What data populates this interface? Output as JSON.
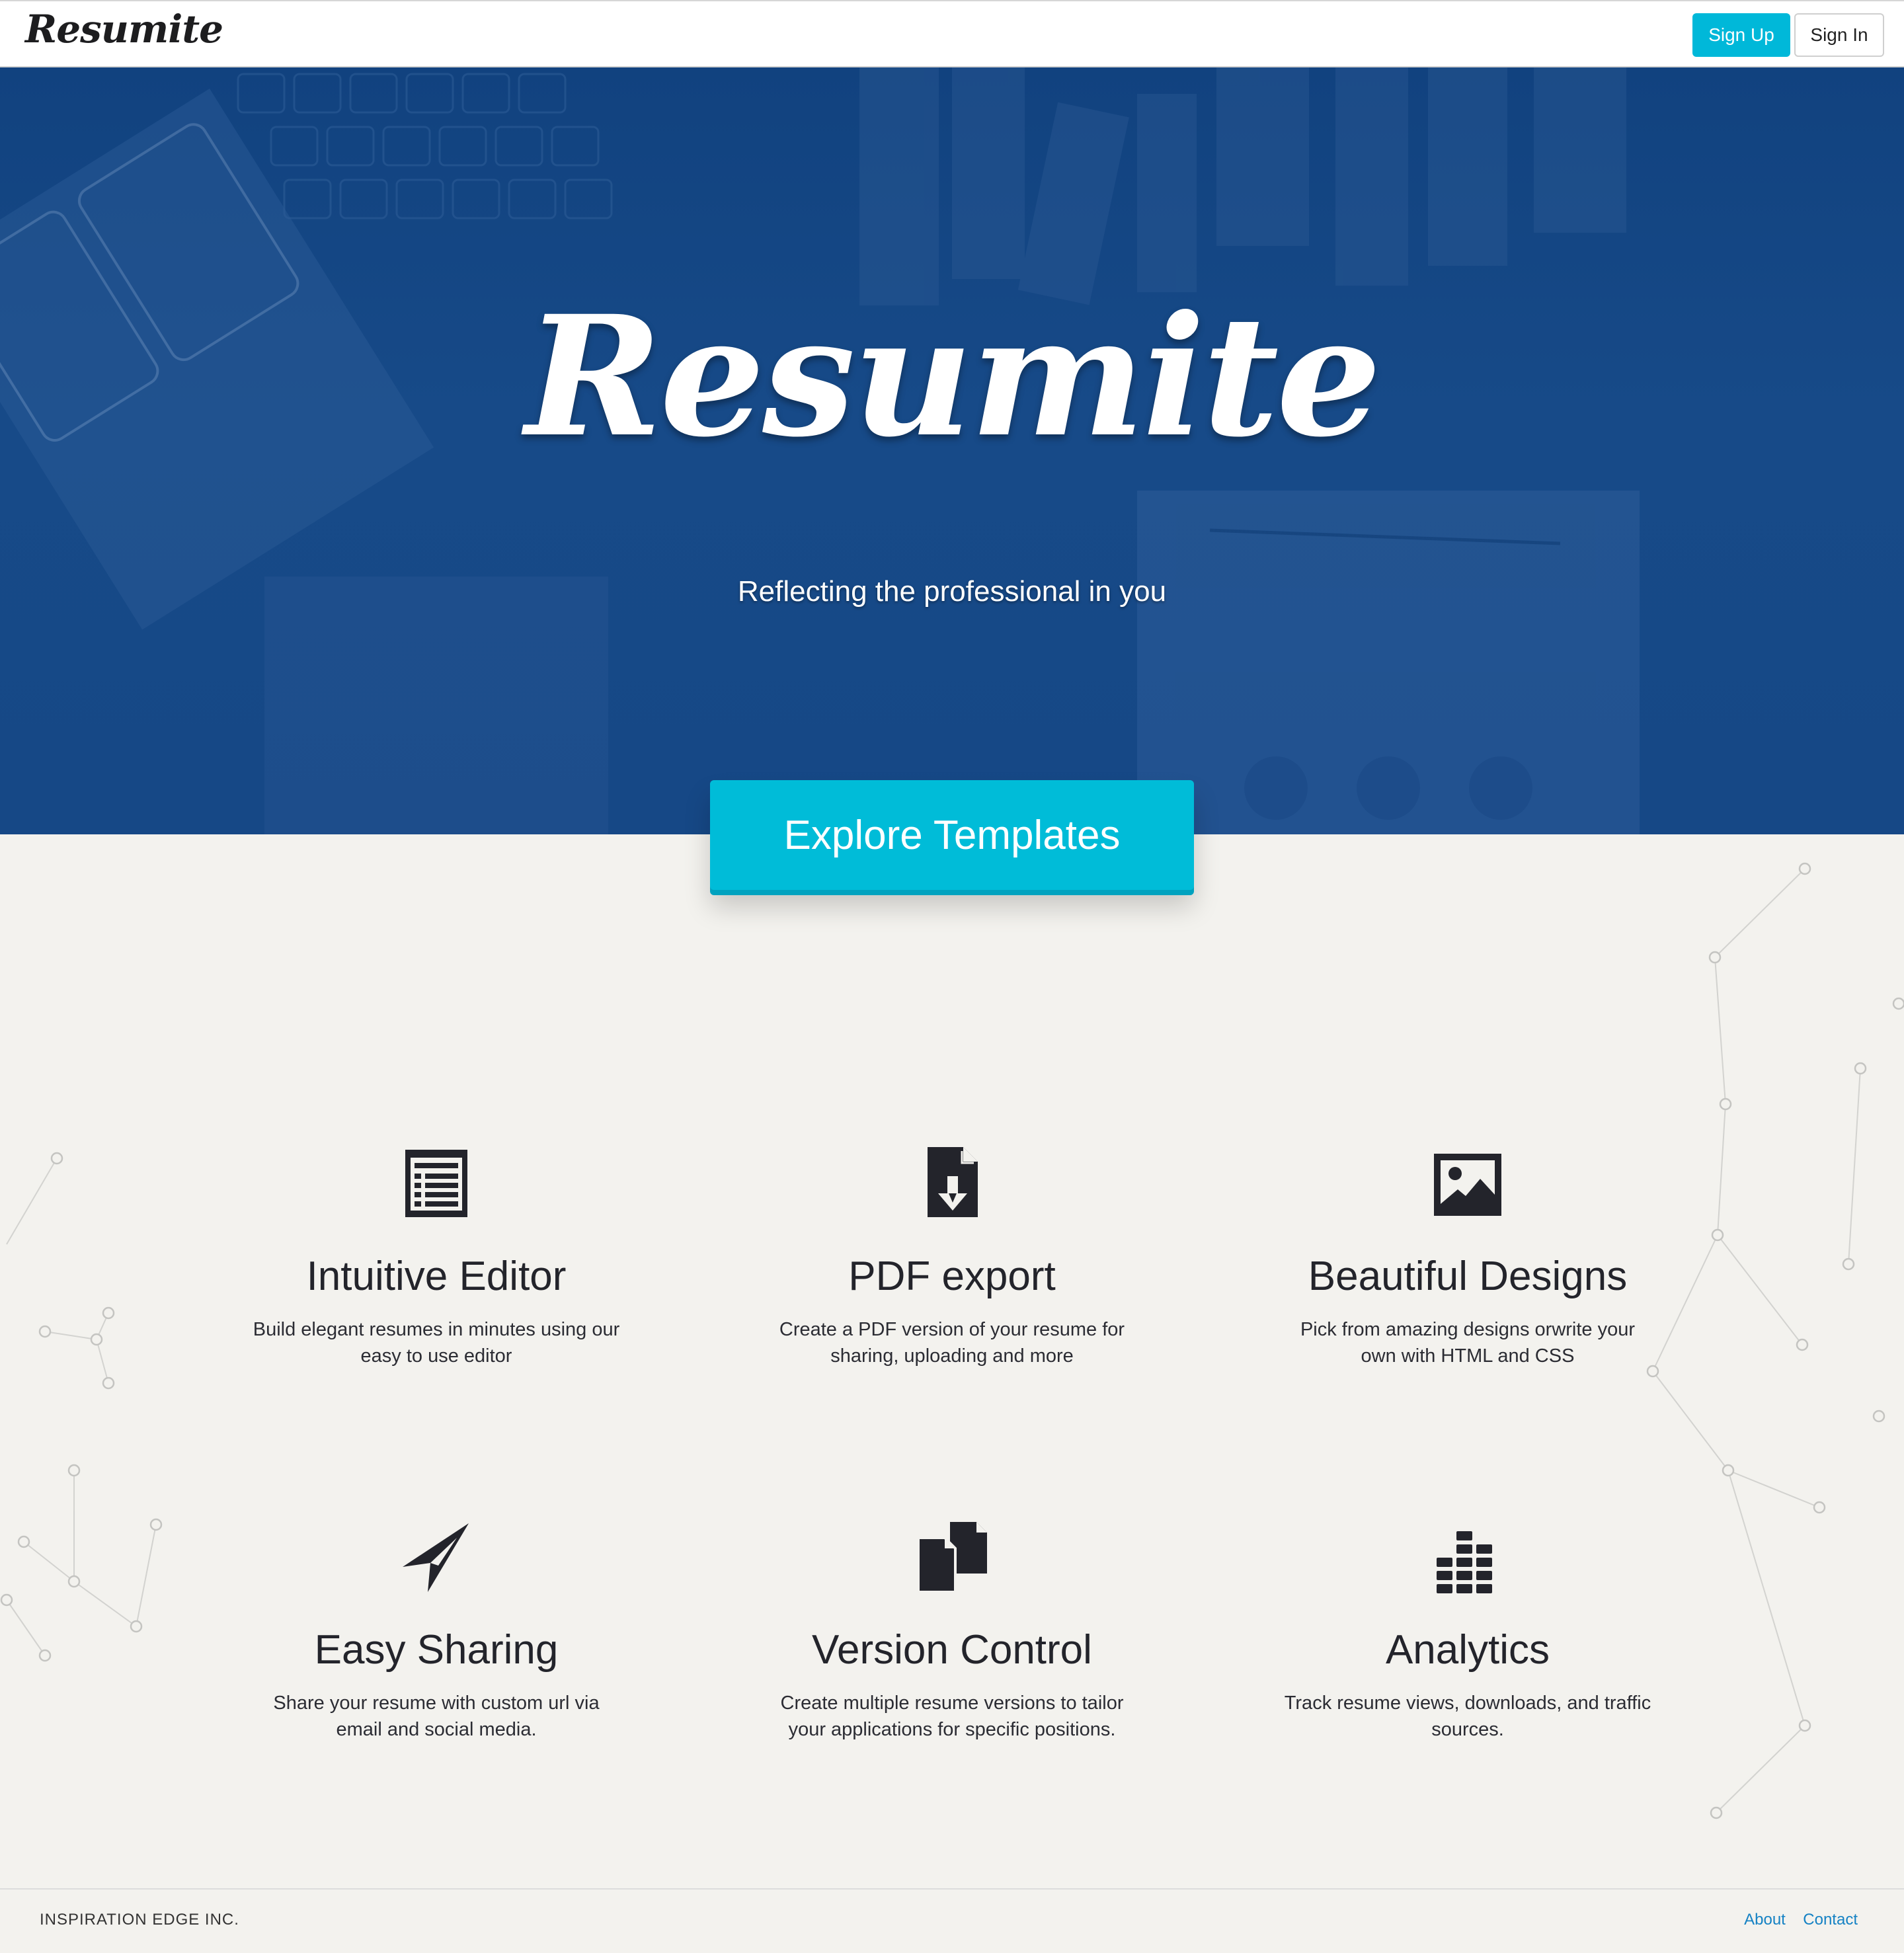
{
  "navbar": {
    "brand": "Resumite",
    "signup_label": "Sign Up",
    "signin_label": "Sign In"
  },
  "hero": {
    "title": "Resumite",
    "tagline": "Reflecting the professional in you",
    "cta_label": "Explore Templates"
  },
  "features": [
    {
      "title": "Intuitive Editor",
      "description": "Build elegant resumes in minutes using our easy to use editor",
      "icon": "list-document-icon"
    },
    {
      "title": "PDF export",
      "description": "Create a PDF version of your resume for sharing, uploading and more",
      "icon": "file-download-icon"
    },
    {
      "title": "Beautiful Designs",
      "description": "Pick from amazing designs orwrite your own with HTML and CSS",
      "icon": "image-icon"
    },
    {
      "title": "Easy Sharing",
      "description": "Share your resume with custom url via email and social media.",
      "icon": "paper-plane-icon"
    },
    {
      "title": "Version Control",
      "description": "Create multiple resume versions to tailor your applications for specific positions.",
      "icon": "copy-documents-icon"
    },
    {
      "title": "Analytics",
      "description": "Track resume views, downloads, and traffic sources.",
      "icon": "bar-blocks-icon"
    }
  ],
  "footer": {
    "company": "INSPIRATION EDGE INC.",
    "links": [
      "About",
      "Contact"
    ]
  },
  "colors": {
    "accent": "#00b8d9",
    "hero_blue": "#164886",
    "page_bg": "#f3f2ee",
    "text_dark": "#23242b",
    "footer_link": "#1582c4"
  }
}
